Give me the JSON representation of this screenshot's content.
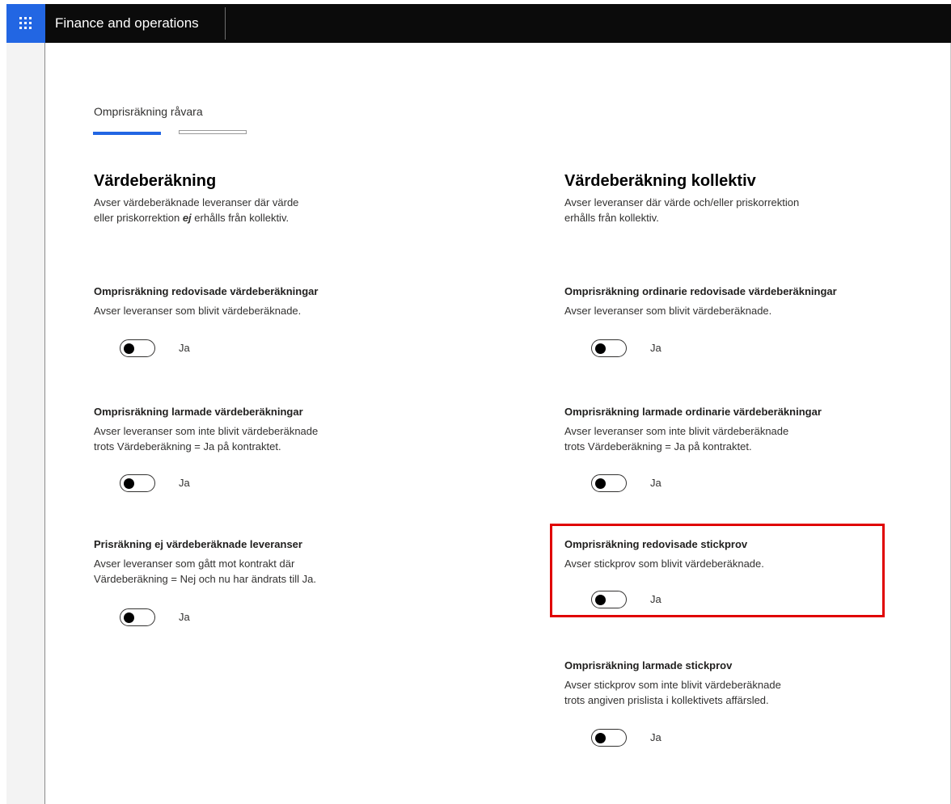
{
  "app": {
    "title": "Finance and operations"
  },
  "tabs": [
    {
      "label": "Omprisräkning råvara"
    }
  ],
  "left_column": {
    "title": "Värdeberäkning",
    "desc_part1": "Avser värdeberäknade leveranser där värde",
    "desc_part2": "eller priskorrektion ",
    "desc_emphasis": "ej",
    "desc_part3": " erhålls från kollektiv.",
    "settings": [
      {
        "title": "Omprisräkning redovisade värdeberäkningar",
        "desc1": "Avser leveranser som blivit värdeberäknade.",
        "desc2": "",
        "toggle_label": "Ja"
      },
      {
        "title": "Omprisräkning larmade värdeberäkningar",
        "desc1": "Avser leveranser som inte blivit värdeberäknade",
        "desc2": "trots Värdeberäkning = Ja på kontraktet.",
        "toggle_label": "Ja"
      },
      {
        "title": "Prisräkning ej värdeberäknade leveranser",
        "desc1": "Avser leveranser som gått mot kontrakt där",
        "desc2": "Värdeberäkning = Nej och nu har ändrats till Ja.",
        "toggle_label": "Ja"
      }
    ]
  },
  "right_column": {
    "title": "Värdeberäkning kollektiv",
    "desc1": "Avser leveranser där värde och/eller priskorrektion",
    "desc2": "erhålls från kollektiv.",
    "settings": [
      {
        "title": "Omprisräkning ordinarie redovisade värdeberäkningar",
        "desc1": "Avser leveranser som blivit värdeberäknade.",
        "desc2": "",
        "toggle_label": "Ja"
      },
      {
        "title": "Omprisräkning larmade ordinarie värdeberäkningar",
        "desc1": "Avser leveranser som inte blivit värdeberäknade",
        "desc2": "trots Värdeberäkning = Ja på kontraktet.",
        "toggle_label": "Ja"
      },
      {
        "title": "Omprisräkning redovisade stickprov",
        "desc1": "Avser stickprov som blivit värdeberäknade.",
        "desc2": "",
        "toggle_label": "Ja"
      },
      {
        "title": "Omprisräkning larmade stickprov",
        "desc1": "Avser stickprov som inte blivit värdeberäknade",
        "desc2": "trots angiven prislista i kollektivets affärsled.",
        "toggle_label": "Ja"
      }
    ]
  },
  "colors": {
    "accent": "#2266e3",
    "topbar": "#0b0b0b",
    "highlight": "#e00000"
  },
  "icons": {
    "app_launcher": "waffle-icon"
  }
}
